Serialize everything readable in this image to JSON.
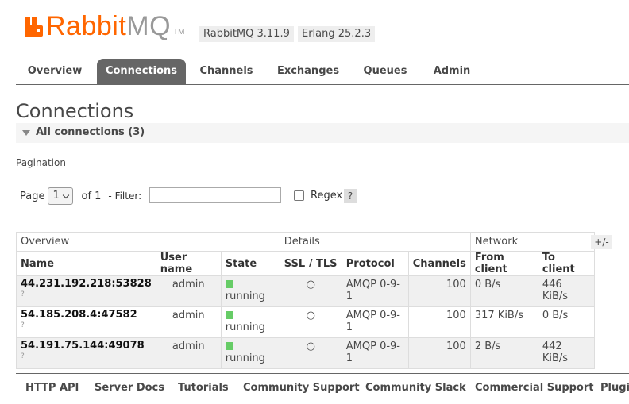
{
  "header": {
    "logo_text_rabbit": "Rabbit",
    "logo_text_mq": "MQ",
    "logo_tm": "TM",
    "version": "RabbitMQ 3.11.9",
    "erlang": "Erlang 25.2.3"
  },
  "tabs": [
    {
      "label": "Overview",
      "active": false
    },
    {
      "label": "Connections",
      "active": true
    },
    {
      "label": "Channels",
      "active": false
    },
    {
      "label": "Exchanges",
      "active": false
    },
    {
      "label": "Queues",
      "active": false
    },
    {
      "label": "Admin",
      "active": false
    }
  ],
  "page_title": "Connections",
  "section": {
    "label": "All connections (3)"
  },
  "pagination": {
    "label": "Pagination",
    "page_label": "Page",
    "page_value": "1",
    "of_label": "of 1",
    "filter_label": "- Filter:",
    "filter_value": "",
    "regex_label": "Regex",
    "regex_checked": false,
    "help_label": "?"
  },
  "table": {
    "groups": [
      "Overview",
      "Details",
      "Network"
    ],
    "columns": [
      "Name",
      "User name",
      "State",
      "SSL / TLS",
      "Protocol",
      "Channels",
      "From client",
      "To client"
    ],
    "rows": [
      {
        "name": "44.231.192.218:53828",
        "q": "?",
        "user": "admin",
        "state": "running",
        "ssl": "○",
        "protocol": "AMQP 0-9-1",
        "channels": "100",
        "from": "0 B/s",
        "to": "446 KiB/s"
      },
      {
        "name": "54.185.208.4:47582",
        "q": "?",
        "user": "admin",
        "state": "running",
        "ssl": "○",
        "protocol": "AMQP 0-9-1",
        "channels": "100",
        "from": "317 KiB/s",
        "to": "0 B/s"
      },
      {
        "name": "54.191.75.144:49078",
        "q": "?",
        "user": "admin",
        "state": "running",
        "ssl": "○",
        "protocol": "AMQP 0-9-1",
        "channels": "100",
        "from": "2 B/s",
        "to": "442 KiB/s"
      }
    ],
    "columns_toggle": "+/-"
  },
  "footer": [
    "HTTP API",
    "Server Docs",
    "Tutorials",
    "Community Support",
    "Community Slack",
    "Commercial Support",
    "Plugins"
  ],
  "colors": {
    "brand": "#ff6600",
    "running": "#66cc66",
    "active_tab": "#666666"
  }
}
